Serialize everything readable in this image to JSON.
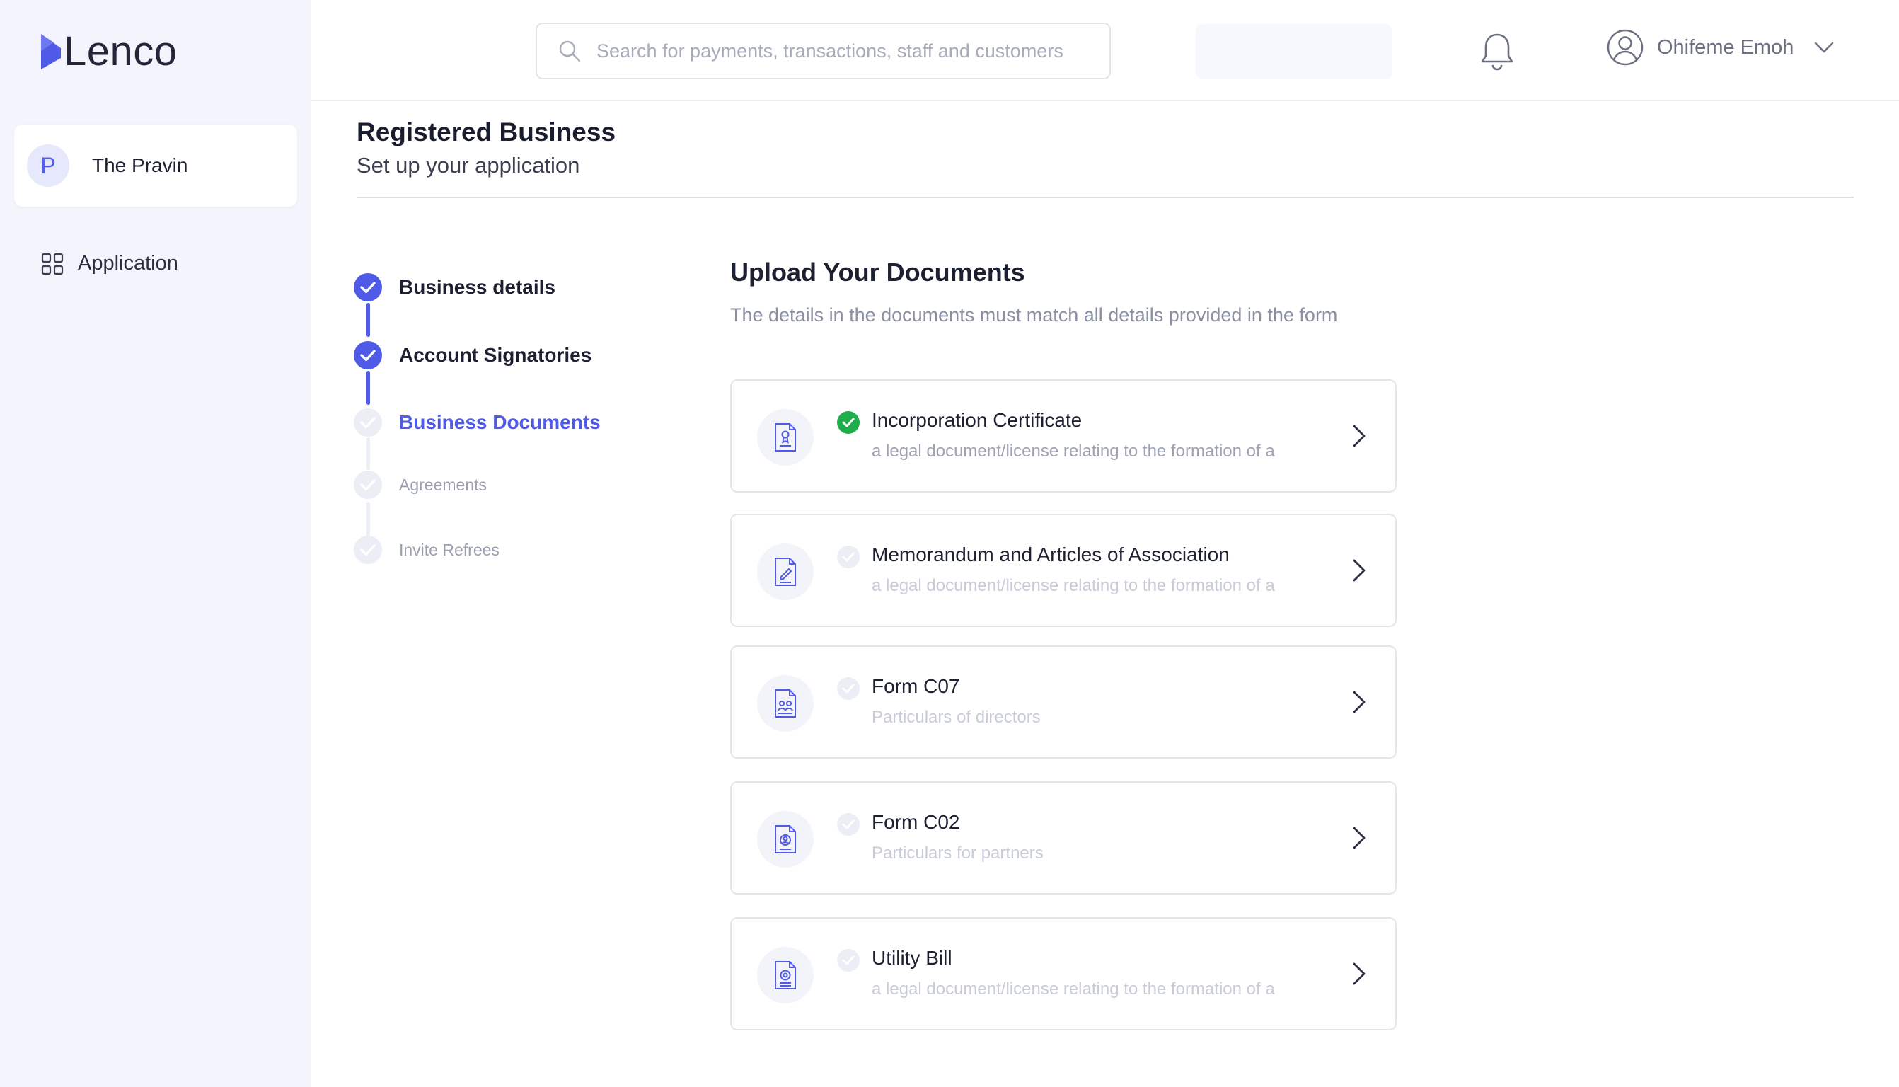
{
  "brand": {
    "name": "Lenco",
    "color": "#4f5ae6"
  },
  "sidebar": {
    "account": {
      "initial": "P",
      "name": "The Pravin"
    },
    "items": [
      {
        "label": "Application",
        "icon": "grid-icon"
      }
    ]
  },
  "header": {
    "search_placeholder": "Search for payments, transactions, staff and customers",
    "user_name": "Ohifeme Emoh"
  },
  "page": {
    "title": "Registered Business",
    "subtitle": "Set up your application"
  },
  "steps": [
    {
      "label": "Business details",
      "state": "done"
    },
    {
      "label": "Account Signatories",
      "state": "done"
    },
    {
      "label": "Business Documents",
      "state": "active"
    },
    {
      "label": "Agreements",
      "state": "todo"
    },
    {
      "label": "Invite Refrees",
      "state": "todo"
    }
  ],
  "documents": {
    "title": "Upload Your Documents",
    "description": "The details in the documents must match all details provided in the form",
    "items": [
      {
        "title": "Incorporation Certificate",
        "description": "a legal document/license relating to the formation of a",
        "uploaded": true,
        "icon": "certificate-file-icon"
      },
      {
        "title": "Memorandum and Articles of Association",
        "description": "a legal document/license relating to the formation of a",
        "uploaded": false,
        "icon": "signed-file-icon"
      },
      {
        "title": "Form C07",
        "description": "Particulars of directors",
        "uploaded": false,
        "icon": "directors-file-icon"
      },
      {
        "title": "Form C02",
        "description": "Particulars for partners",
        "uploaded": false,
        "icon": "partners-file-icon"
      },
      {
        "title": "Utility Bill",
        "description": "a legal document/license relating to the formation of a",
        "uploaded": false,
        "icon": "bill-file-icon"
      }
    ]
  },
  "colors": {
    "accent": "#4f5ae6",
    "success": "#1fae4b",
    "step_inactive": "#e8eaf3",
    "sidebar_bg": "#f4f5fc"
  }
}
